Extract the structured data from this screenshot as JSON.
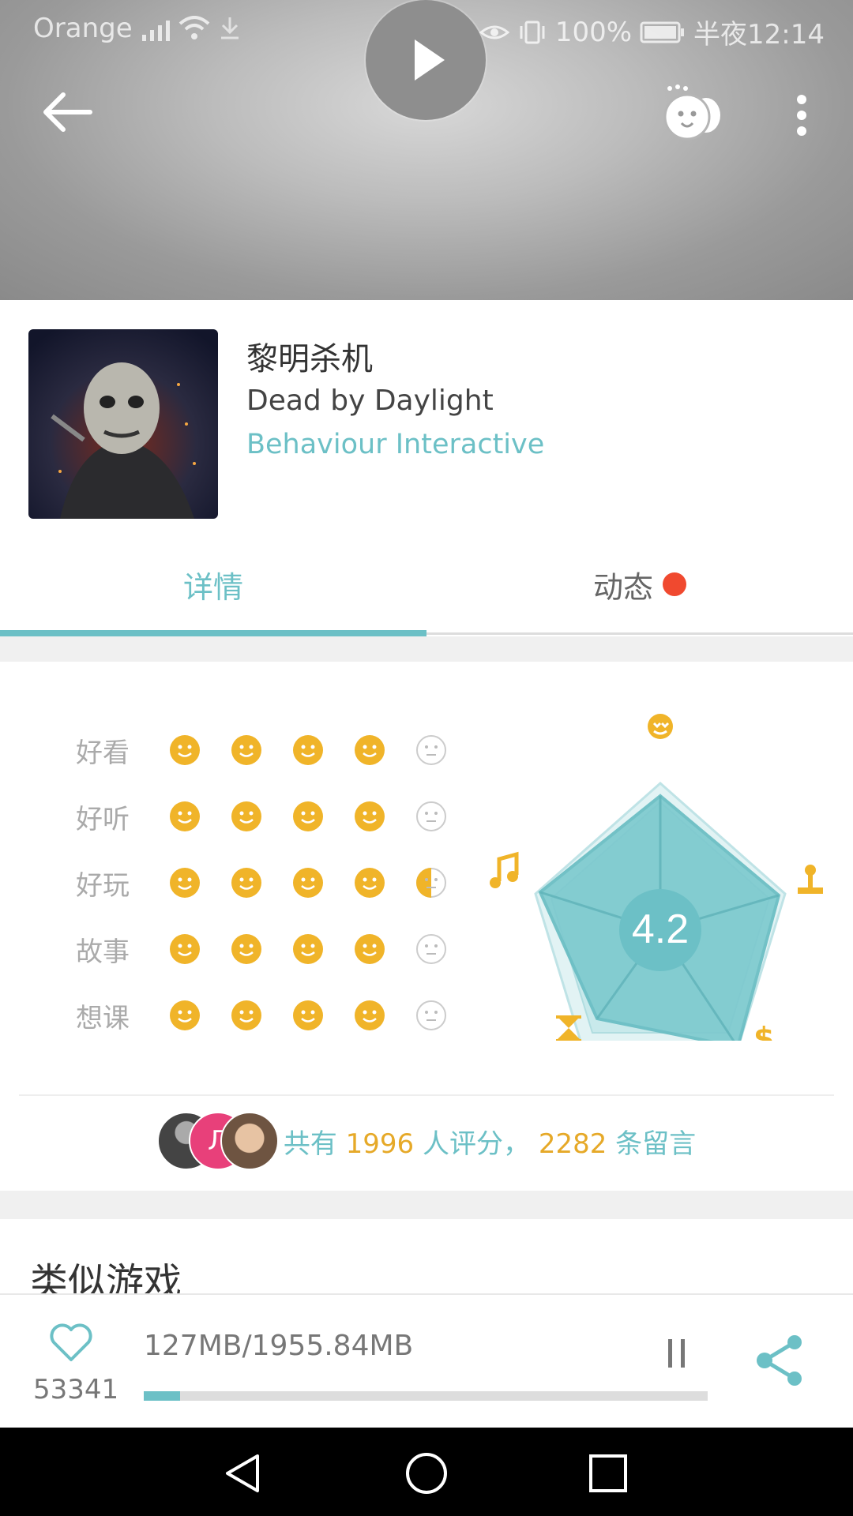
{
  "statusbar": {
    "carrier": "Orange",
    "battery": "100%",
    "time": "半夜12:14"
  },
  "header": {
    "back_icon": "arrow-left-icon",
    "play_icon": "play-icon",
    "emoji_icon": "emoji-chat-icon",
    "more_icon": "more-vertical-icon"
  },
  "game": {
    "title_cn": "黎明杀机",
    "title_en": "Dead by Daylight",
    "developer": "Behaviour Interactive"
  },
  "tabs": [
    {
      "label": "详情",
      "active": true
    },
    {
      "label": "动态",
      "badge": true
    }
  ],
  "ratings": {
    "rows": [
      {
        "label": "好看",
        "score": 4
      },
      {
        "label": "好听",
        "score": 4
      },
      {
        "label": "好玩",
        "score": 4.5
      },
      {
        "label": "故事",
        "score": 4
      },
      {
        "label": "想课",
        "score": 4
      }
    ],
    "overall": "4.2",
    "axis_icons": [
      "love-face-icon",
      "joystick-icon",
      "dollar-icon",
      "hourglass-icon",
      "music-note-icon"
    ]
  },
  "summary": {
    "prefix": "共有 ",
    "raters": "1996",
    "mid": " 人评分， ",
    "comments": "2282",
    "suffix": " 条留言"
  },
  "similar": {
    "title": "类似游戏"
  },
  "bottom": {
    "like_count": "53341",
    "download_size": "127MB/1955.84MB",
    "progress": 0.065
  },
  "colors": {
    "accent": "#6cc0c6",
    "face": "#f0b429",
    "badge": "#f0492f"
  }
}
